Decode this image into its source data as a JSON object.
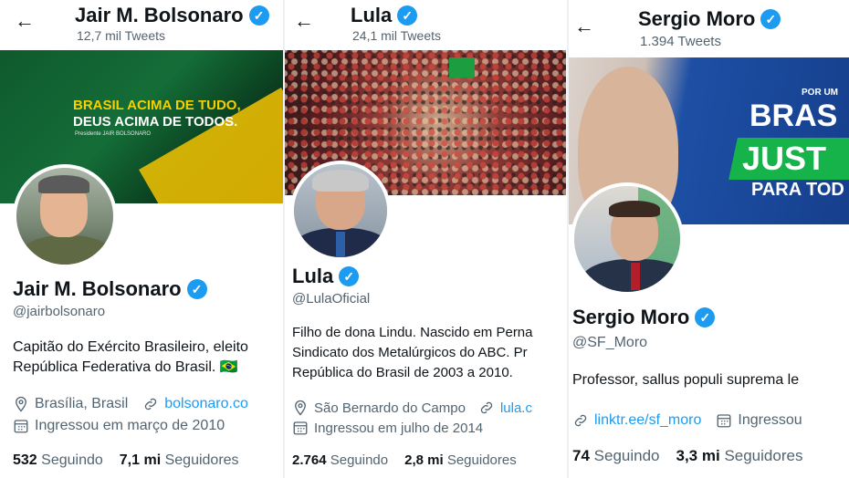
{
  "colors": {
    "verified": "#1d9bf0",
    "link": "#1d9bf0",
    "secondary_text": "#536471",
    "primary_text": "#0f1419"
  },
  "profiles": [
    {
      "header_name": "Jair M. Bolsonaro",
      "tweets": "12,7 mil Tweets",
      "banner_line1": "BRASIL ACIMA DE TUDO,",
      "banner_line2": "DEUS ACIMA DE TODOS.",
      "banner_line3": "Presidente JAIR BOLSONARO",
      "name": "Jair M. Bolsonaro",
      "handle": "@jairbolsonaro",
      "bio_line1": "Capitão do Exército Brasileiro, eleito",
      "bio_line2": "República Federativa do Brasil. 🇧🇷",
      "location": "Brasília, Brasil",
      "website": "bolsonaro.co",
      "joined": "Ingressou em março de 2010",
      "following_count": "532",
      "following_label": "Seguindo",
      "followers_count": "7,1 mi",
      "followers_label": "Seguidores"
    },
    {
      "header_name": "Lula",
      "tweets": "24,1 mil Tweets",
      "name": "Lula",
      "handle": "@LulaOficial",
      "bio_line1": "Filho de dona Lindu. Nascido em Perna",
      "bio_line2": "Sindicato dos Metalúrgicos do ABC. Pr",
      "bio_line3": "República do Brasil de 2003 a 2010.",
      "location": "São Bernardo do Campo",
      "website": "lula.c",
      "joined": "Ingressou em julho de 2014",
      "following_count": "2.764",
      "following_label": "Seguindo",
      "followers_count": "2,8 mi",
      "followers_label": "Seguidores"
    },
    {
      "header_name": "Sergio Moro",
      "tweets": "1.394 Tweets",
      "banner_por": "POR UM",
      "banner_brasil": "BRAS",
      "banner_justo": "JUST",
      "banner_para": "PARA TOD",
      "name": "Sergio Moro",
      "handle": "@SF_Moro",
      "bio_line1": "Professor, sallus populi suprema le",
      "website": "linktr.ee/sf_moro",
      "joined": "Ingressou",
      "following_count": "74",
      "following_label": "Seguindo",
      "followers_count": "3,3 mi",
      "followers_label": "Seguidores"
    }
  ],
  "icons": {
    "back": "back-arrow-icon",
    "verified": "verified-badge-icon",
    "location": "location-pin-icon",
    "link": "link-icon",
    "calendar": "calendar-icon"
  }
}
